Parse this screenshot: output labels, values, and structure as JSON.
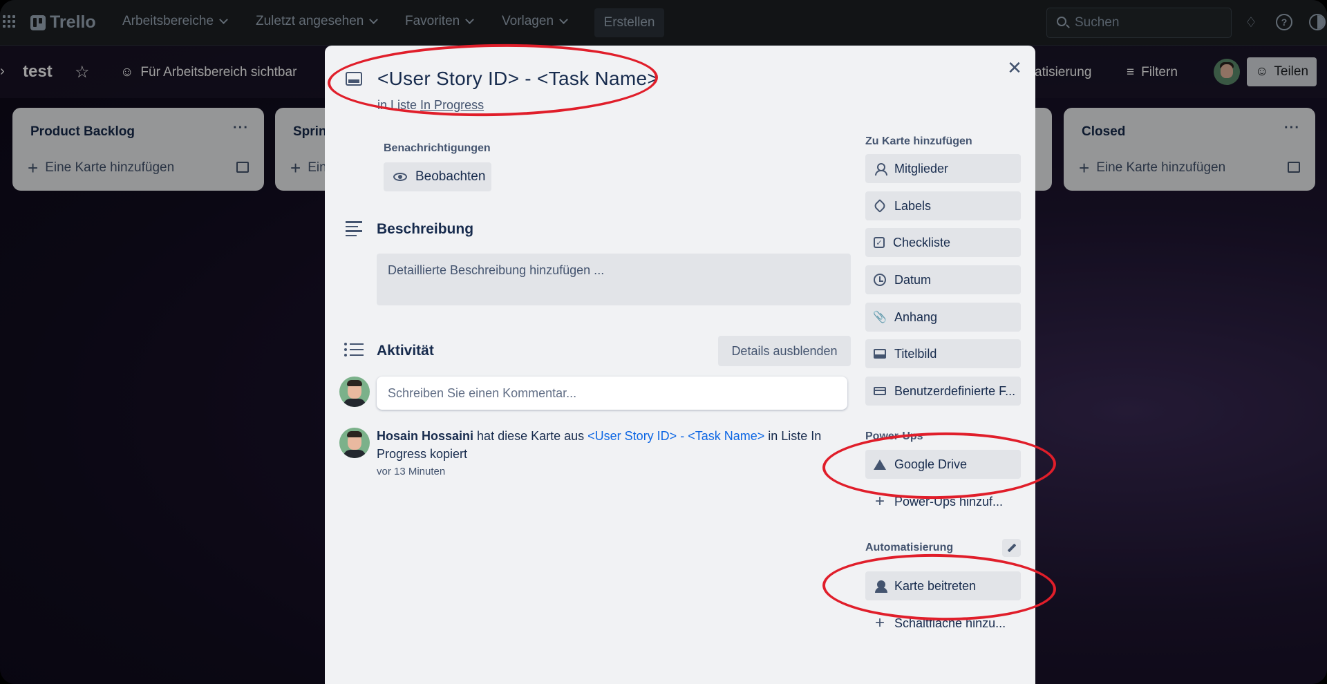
{
  "topbar": {
    "logo": "Trello",
    "nav": [
      {
        "label": "Arbeitsbereiche"
      },
      {
        "label": "Zuletzt angesehen"
      },
      {
        "label": "Favoriten"
      },
      {
        "label": "Vorlagen"
      }
    ],
    "create_label": "Erstellen",
    "search_placeholder": "Suchen"
  },
  "board": {
    "title": "test",
    "visibility": "Für Arbeitsbereich sichtbar",
    "automation_fragment": "atisierung",
    "filter": "Filtern",
    "share": "Teilen",
    "lists": [
      {
        "title": "Product Backlog",
        "add": "Eine Karte hinzufügen"
      },
      {
        "title": "Sprin",
        "add": "Ein"
      },
      {
        "title": "Closed",
        "add": "Eine Karte hinzufügen"
      }
    ]
  },
  "card": {
    "title": "<User Story ID> - <Task Name>",
    "list_prefix": "in Liste ",
    "list_name": "In Progress",
    "notifications_label": "Benachrichtigungen",
    "watch_label": "Beobachten",
    "description_heading": "Beschreibung",
    "description_placeholder": "Detaillierte Beschreibung hinzufügen ...",
    "activity_heading": "Aktivität",
    "hide_details": "Details ausblenden",
    "comment_placeholder": "Schreiben Sie einen Kommentar...",
    "activity": {
      "user": "Hosain Hossaini",
      "text_before": " hat diese Karte aus ",
      "card_link": "<User Story ID> - <Task Name>",
      "text_after": " in Liste In Progress kopiert",
      "time": "vor 13 Minuten"
    }
  },
  "sidebar": {
    "add_heading": "Zu Karte hinzufügen",
    "add_items": [
      {
        "label": "Mitglieder",
        "icon": "user-icon"
      },
      {
        "label": "Labels",
        "icon": "tag-icon"
      },
      {
        "label": "Checkliste",
        "icon": "checklist-icon"
      },
      {
        "label": "Datum",
        "icon": "clock-icon"
      },
      {
        "label": "Anhang",
        "icon": "paperclip-icon"
      },
      {
        "label": "Titelbild",
        "icon": "cover-icon"
      },
      {
        "label": "Benutzerdefinierte F...",
        "icon": "custom-field-icon"
      }
    ],
    "powerups_heading": "Power-Ups",
    "google_drive": "Google Drive",
    "add_powerups": "Power-Ups hinzuf...",
    "automation_heading": "Automatisierung",
    "join_card": "Karte beitreten",
    "add_button": "Schaltfläche hinzu..."
  },
  "colors": {
    "annotation": "#e01e2a",
    "link": "#0c66e4",
    "topbar": "#1d2125"
  }
}
